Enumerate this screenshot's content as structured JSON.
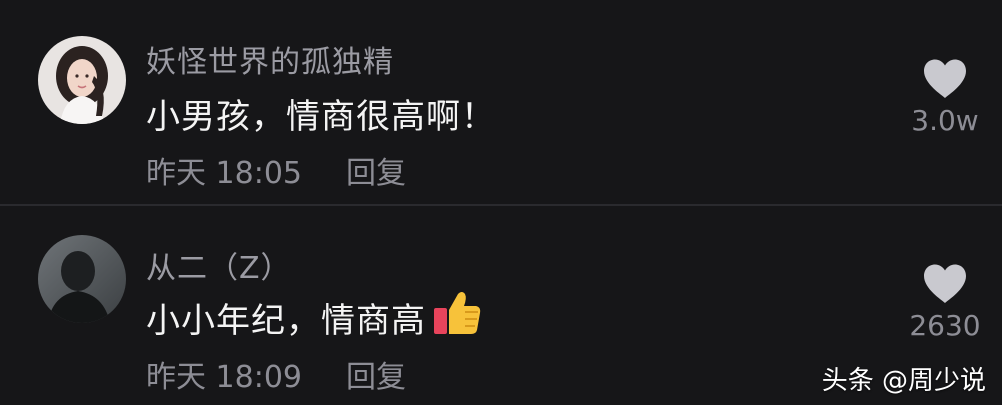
{
  "colors": {
    "background": "#161618",
    "divider": "#2a2a2e",
    "username": "#9b9ba3",
    "text": "#f4f4f4",
    "meta": "#8d8d95",
    "like_icon": "#c9c9cf"
  },
  "comments": [
    {
      "username": "妖怪世界的孤独精",
      "text": "小男孩，情商很高啊！",
      "time": "昨天 18:05",
      "reply_label": "回复",
      "like_count": "3.0w",
      "like_icon": "heart-icon"
    },
    {
      "username": "从二（Z）",
      "text": "小小年纪，情商高",
      "emoji": "thumbs-up-icon",
      "time": "昨天 18:09",
      "reply_label": "回复",
      "like_count": "2630",
      "like_icon": "heart-icon"
    }
  ],
  "watermark": "头条 @周少说"
}
